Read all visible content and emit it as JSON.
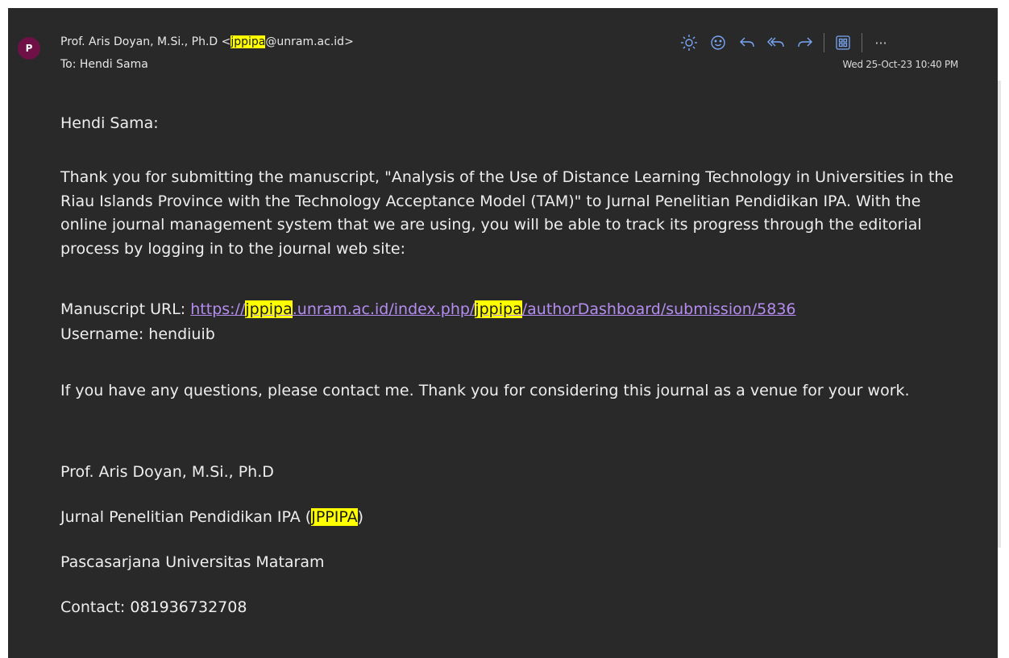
{
  "header": {
    "avatar_initial": "P",
    "from_prefix": "Prof. Aris Doyan, M.Si., Ph.D <",
    "from_highlight": "jppipa",
    "from_suffix": "@unram.ac.id>",
    "to": "To: Hendi Sama",
    "date": "Wed 25-Oct-23 10:40 PM"
  },
  "toolbar": {
    "icons": [
      "sun-icon",
      "emoji-icon",
      "reply-icon",
      "reply-all-icon",
      "forward-icon",
      "apps-icon",
      "more-icon"
    ],
    "more_label": "···"
  },
  "body": {
    "greeting": "Hendi Sama:",
    "paragraph1": "Thank you for submitting the manuscript, \"Analysis of the Use of Distance Learning Technology in Universities in the Riau Islands Province with the Technology Acceptance Model (TAM)\" to Jurnal Penelitian Pendidikan IPA. With the online journal management system that we are using, you will be able to track its progress through the editorial process by logging in to the journal web site:",
    "url_label": "Manuscript URL: ",
    "url_part1": "https://",
    "url_hl1": "jppipa",
    "url_part2": ".unram.ac.id/index.php/",
    "url_hl2": "jppipa",
    "url_part3": "/authorDashboard/submission/5836",
    "username": "Username: hendiuib",
    "paragraph2": "If you have any questions, please contact me. Thank you for considering this journal as a venue for your work.",
    "sig_name": "Prof. Aris Doyan, M.Si., Ph.D",
    "sig_journal_prefix": "Jurnal Penelitian Pendidikan IPA (",
    "sig_journal_hl": "JPPIPA",
    "sig_journal_suffix": ")",
    "sig_institution": "Pascasarjana Universitas Mataram",
    "sig_contact": "Contact: 081936732708"
  },
  "colors": {
    "background": "#292929",
    "highlight": "#ffff00",
    "link": "#b58cf0",
    "icon_accent": "#7aa7f5",
    "avatar": "#6f1046"
  }
}
